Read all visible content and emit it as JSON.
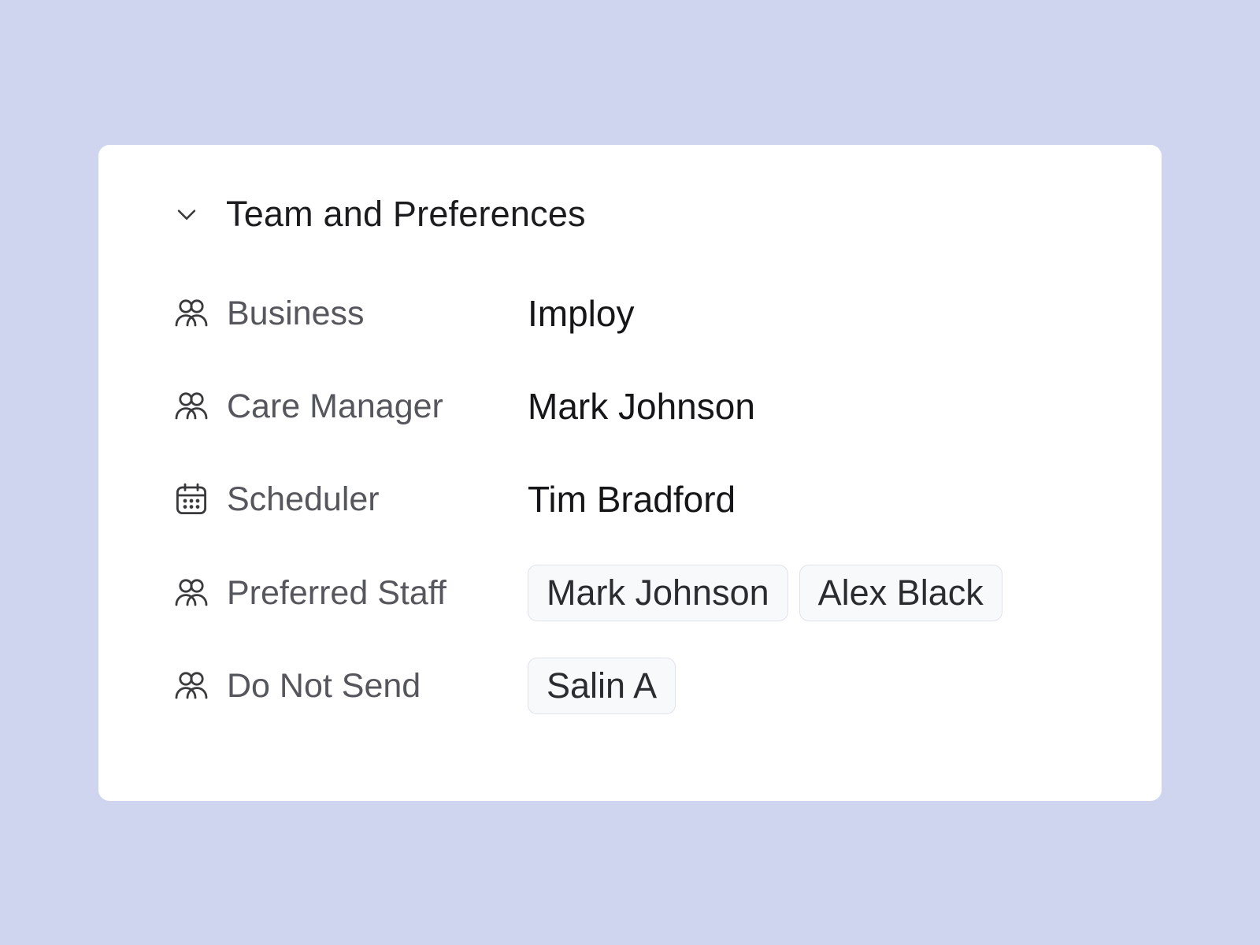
{
  "section": {
    "title": "Team and Preferences",
    "collapse_icon": "chevron-down-icon"
  },
  "rows": [
    {
      "icon": "users-icon",
      "label": "Business",
      "value": "Imploy"
    },
    {
      "icon": "users-icon",
      "label": "Care Manager",
      "value": "Mark Johnson"
    },
    {
      "icon": "calendar-icon",
      "label": "Scheduler",
      "value": "Tim Bradford"
    },
    {
      "icon": "users-icon",
      "label": "Preferred Staff",
      "tags": [
        "Mark Johnson",
        "Alex Black"
      ]
    },
    {
      "icon": "users-icon",
      "label": "Do Not Send",
      "tags": [
        "Salin A"
      ]
    }
  ]
}
